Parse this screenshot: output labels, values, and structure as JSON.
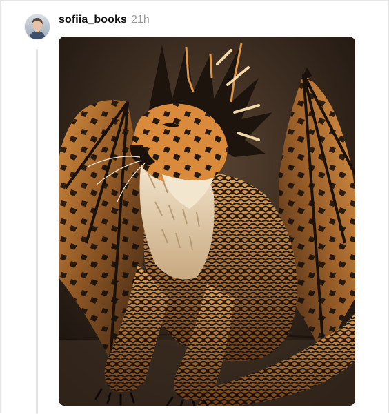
{
  "post": {
    "username": "sofiia_books",
    "timestamp": "21h",
    "avatar_icon": "user-avatar-icon",
    "media": {
      "description_icon": "dragon-artwork-image",
      "accent_colors": [
        "#2a1f17",
        "#d98a3a",
        "#f3e6cf",
        "#141010"
      ]
    }
  }
}
